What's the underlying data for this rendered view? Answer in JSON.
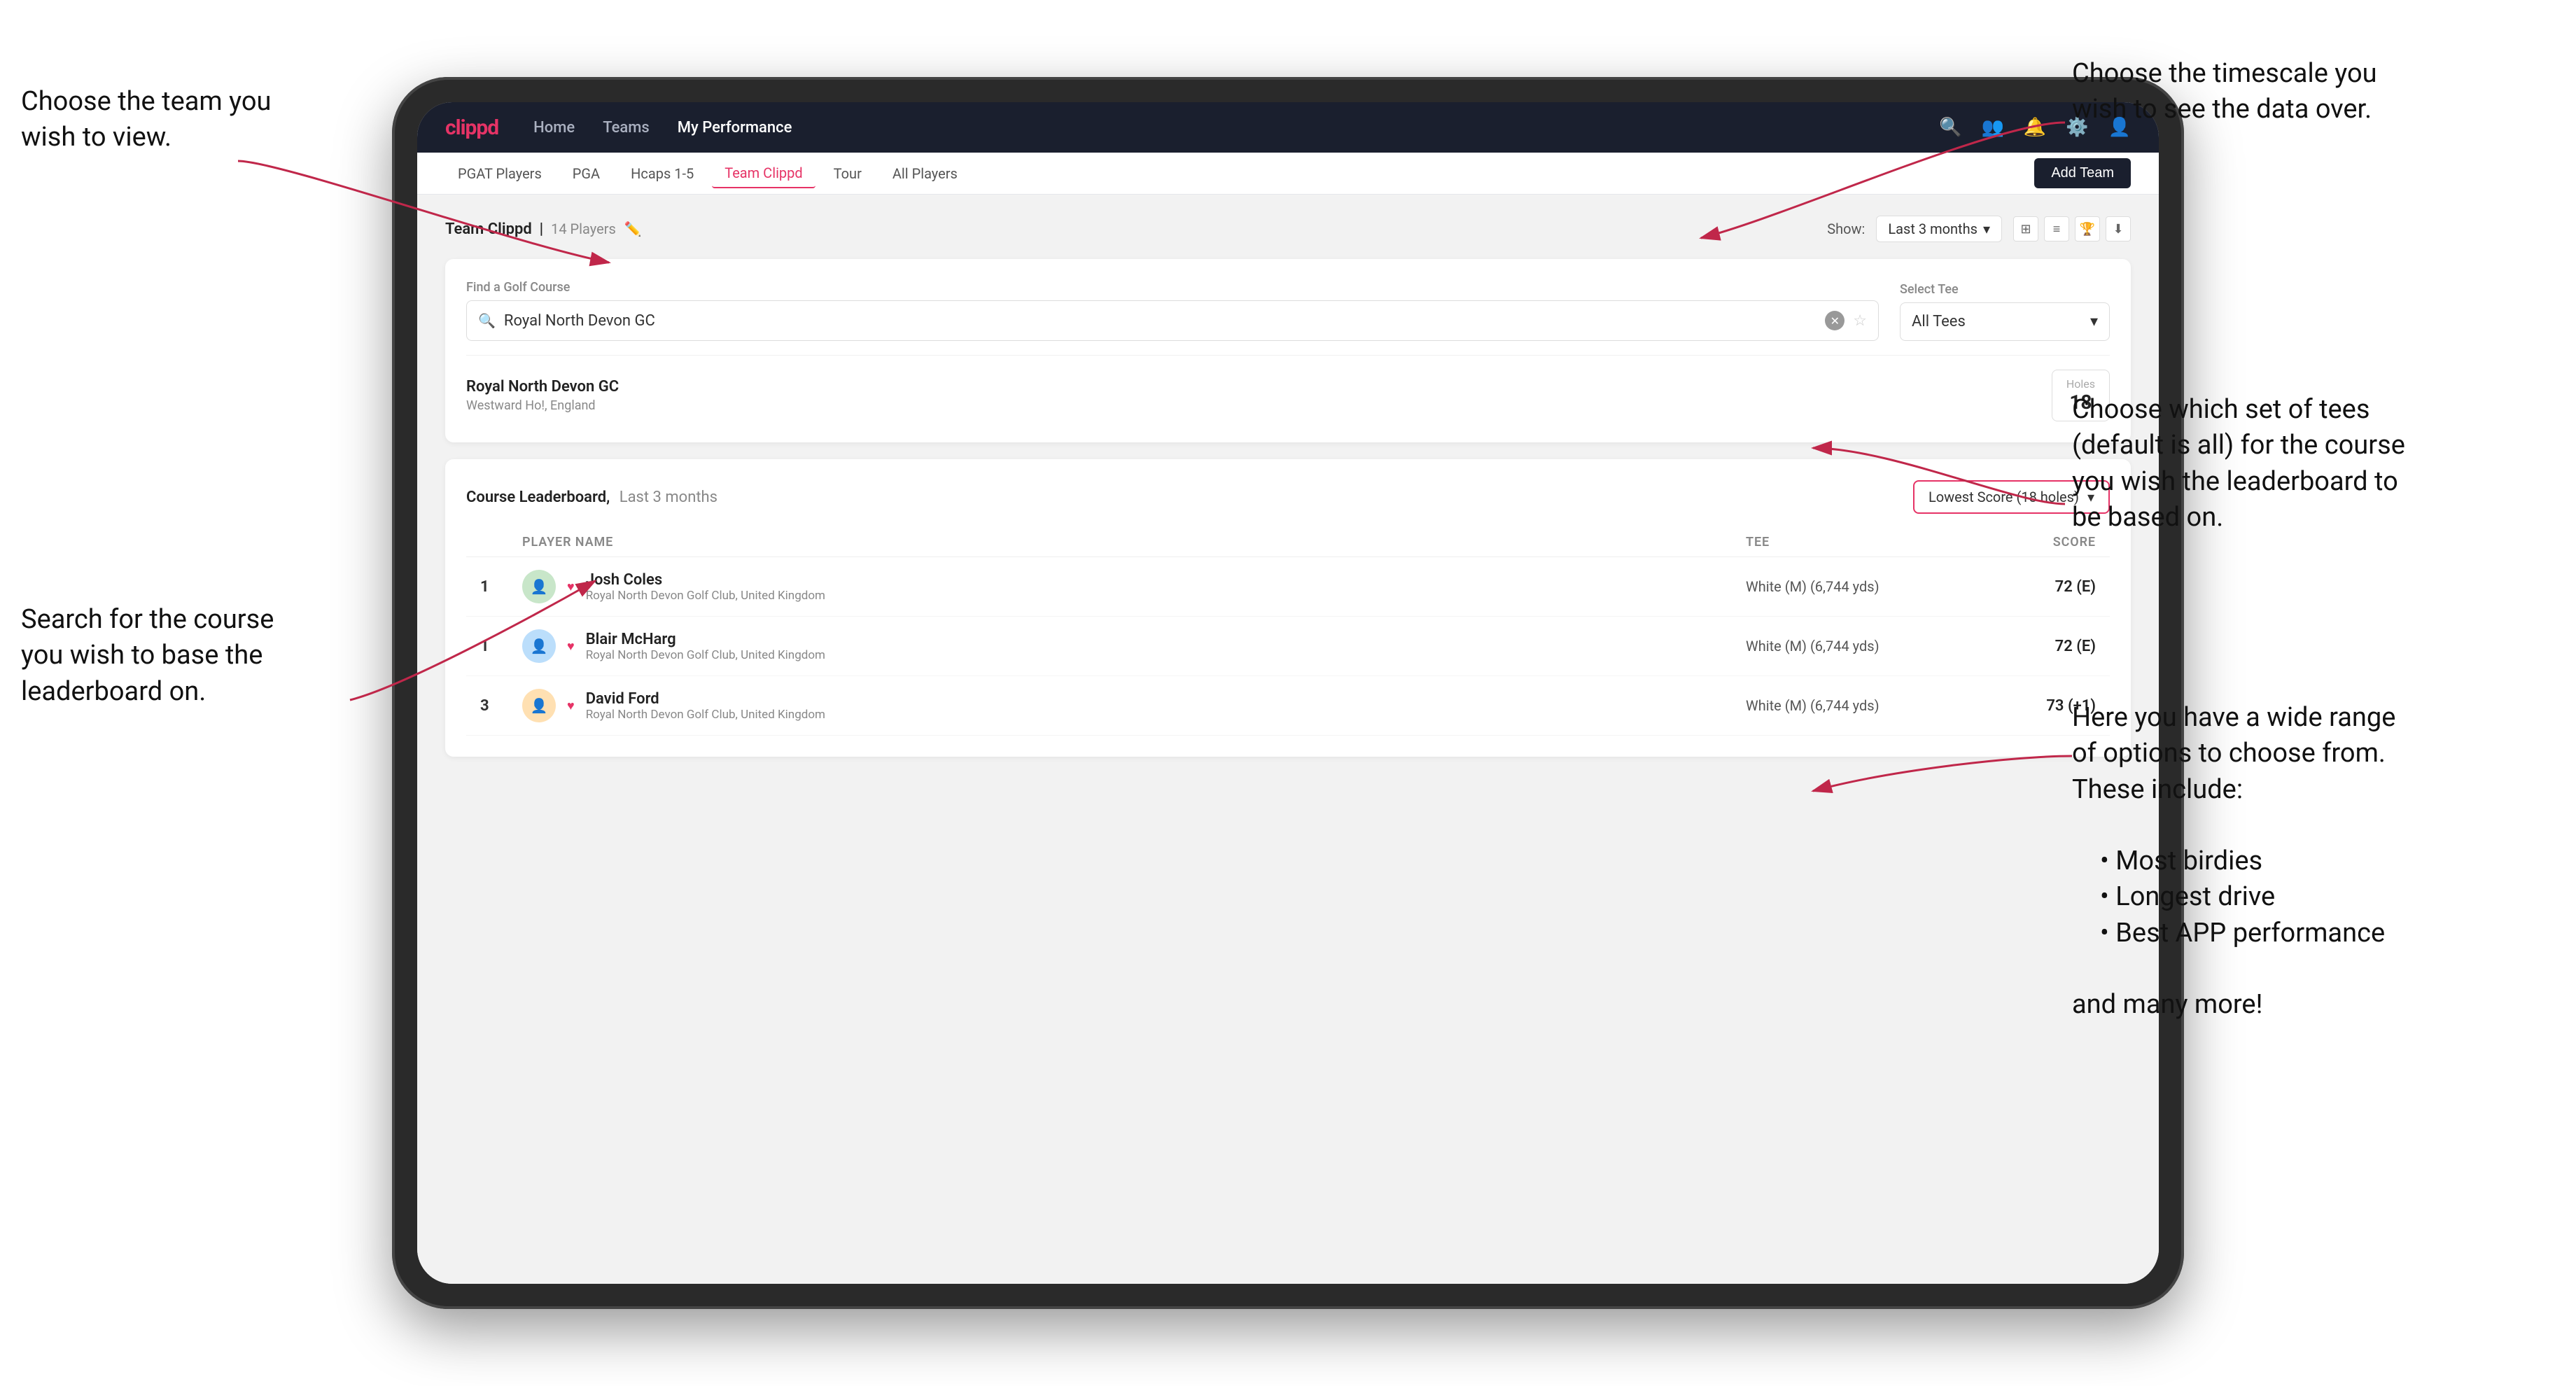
{
  "annotations": {
    "top_left": {
      "title": "Choose the team you",
      "title2": "wish to view."
    },
    "top_right": {
      "title": "Choose the timescale you",
      "title2": "wish to see the data over."
    },
    "middle_right": {
      "title": "Choose which set of tees",
      "title2": "(default is all) for the course",
      "title3": "you wish the leaderboard to",
      "title4": "be based on."
    },
    "bottom_left": {
      "title": "Search for the course",
      "title2": "you wish to base the",
      "title3": "leaderboard on."
    },
    "bottom_right": {
      "title": "Here you have a wide range",
      "title2": "of options to choose from.",
      "title3": "These include:",
      "bullet1": "Most birdies",
      "bullet2": "Longest drive",
      "bullet3": "Best APP performance",
      "footer": "and many more!"
    }
  },
  "nav": {
    "logo": "clippd",
    "links": [
      "Home",
      "Teams",
      "My Performance"
    ],
    "active_link": "My Performance"
  },
  "sub_nav": {
    "items": [
      "PGAT Players",
      "PGA",
      "Hcaps 1-5",
      "Team Clippd",
      "Tour",
      "All Players"
    ],
    "active": "Team Clippd",
    "add_btn": "Add Team"
  },
  "team_header": {
    "title": "Team Clippd",
    "player_count": "14 Players",
    "show_label": "Show:",
    "show_value": "Last 3 months"
  },
  "course_finder": {
    "find_label": "Find a Golf Course",
    "search_value": "Royal North Devon GC",
    "tee_label": "Select Tee",
    "tee_value": "All Tees",
    "result_name": "Royal North Devon GC",
    "result_location": "Westward Ho!, England",
    "holes_label": "Holes",
    "holes_value": "18"
  },
  "leaderboard": {
    "title": "Course Leaderboard,",
    "title_period": "Last 3 months",
    "score_select": "Lowest Score (18 holes)",
    "columns": {
      "rank": "",
      "player": "PLAYER NAME",
      "tee": "TEE",
      "score": "SCORE"
    },
    "rows": [
      {
        "rank": "1",
        "name": "Josh Coles",
        "club": "Royal North Devon Golf Club, United Kingdom",
        "tee": "White (M) (6,744 yds)",
        "score": "72 (E)"
      },
      {
        "rank": "1",
        "name": "Blair McHarg",
        "club": "Royal North Devon Golf Club, United Kingdom",
        "tee": "White (M) (6,744 yds)",
        "score": "72 (E)"
      },
      {
        "rank": "3",
        "name": "David Ford",
        "club": "Royal North Devon Golf Club, United Kingdom",
        "tee": "White (M) (6,744 yds)",
        "score": "73 (+1)"
      }
    ]
  }
}
